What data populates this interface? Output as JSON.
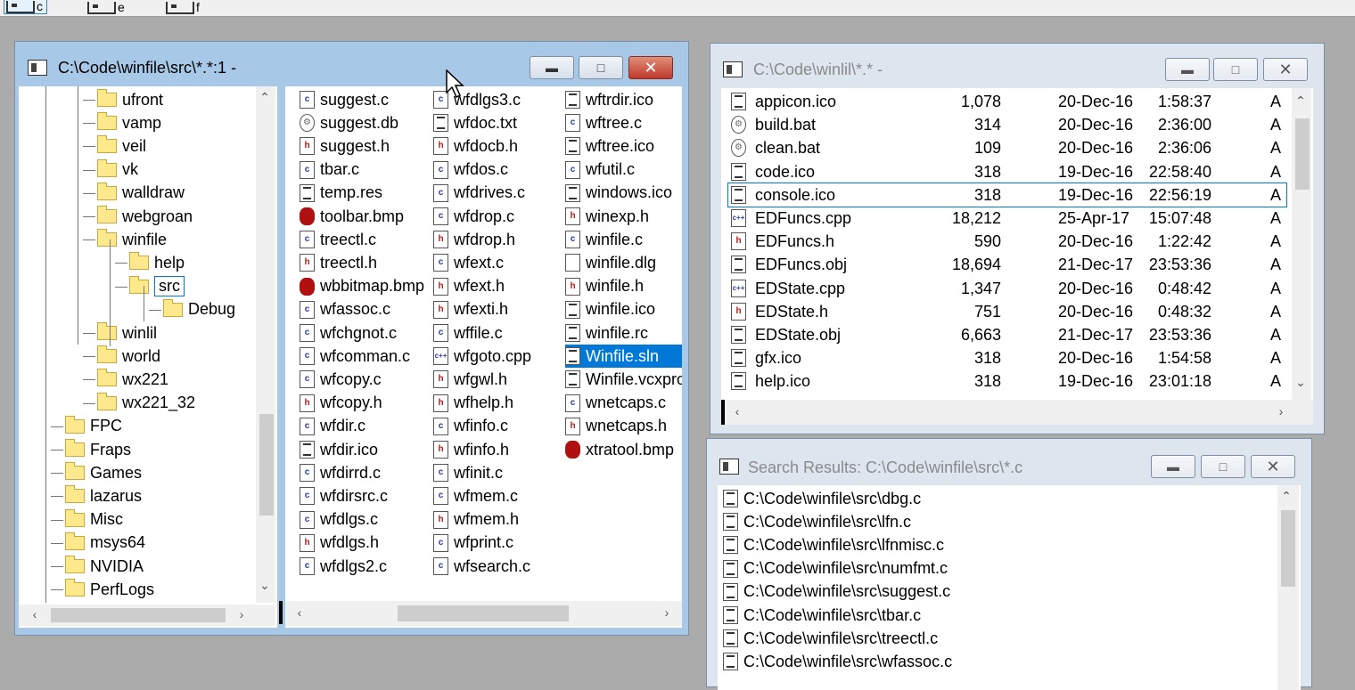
{
  "drivebar": {
    "drives": [
      "c",
      "e",
      "f"
    ]
  },
  "win1": {
    "title": "C:\\Code\\winfile\\src\\*.*:1 -",
    "tree": [
      {
        "label": "ufront"
      },
      {
        "label": "vamp"
      },
      {
        "label": "veil"
      },
      {
        "label": "vk"
      },
      {
        "label": "walldraw"
      },
      {
        "label": "webgroan"
      },
      {
        "label": "winfile"
      },
      {
        "label": "help"
      },
      {
        "label": "src"
      },
      {
        "label": "Debug"
      },
      {
        "label": "winlil"
      },
      {
        "label": "world"
      },
      {
        "label": "wx221"
      },
      {
        "label": "wx221_32"
      },
      {
        "label": "FPC"
      },
      {
        "label": "Fraps"
      },
      {
        "label": "Games"
      },
      {
        "label": "lazarus"
      },
      {
        "label": "Misc"
      },
      {
        "label": "msys64"
      },
      {
        "label": "NVIDIA"
      },
      {
        "label": "PerfLogs"
      }
    ],
    "files_col1": [
      {
        "name": "suggest.c",
        "t": "c"
      },
      {
        "name": "suggest.db",
        "t": "db"
      },
      {
        "name": "suggest.h",
        "t": "h"
      },
      {
        "name": "tbar.c",
        "t": "c"
      },
      {
        "name": "temp.res",
        "t": "doc"
      },
      {
        "name": "toolbar.bmp",
        "t": "bmp"
      },
      {
        "name": "treectl.c",
        "t": "c"
      },
      {
        "name": "treectl.h",
        "t": "h"
      },
      {
        "name": "wbbitmap.bmp",
        "t": "bmp"
      },
      {
        "name": "wfassoc.c",
        "t": "c"
      },
      {
        "name": "wfchgnot.c",
        "t": "c"
      },
      {
        "name": "wfcomman.c",
        "t": "c"
      },
      {
        "name": "wfcopy.c",
        "t": "c"
      },
      {
        "name": "wfcopy.h",
        "t": "h"
      },
      {
        "name": "wfdir.c",
        "t": "c"
      },
      {
        "name": "wfdir.ico",
        "t": "doc"
      },
      {
        "name": "wfdirrd.c",
        "t": "c"
      },
      {
        "name": "wfdirsrc.c",
        "t": "c"
      },
      {
        "name": "wfdlgs.c",
        "t": "c"
      },
      {
        "name": "wfdlgs.h",
        "t": "h"
      },
      {
        "name": "wfdlgs2.c",
        "t": "c"
      }
    ],
    "files_col2": [
      {
        "name": "wfdlgs3.c",
        "t": "c"
      },
      {
        "name": "wfdoc.txt",
        "t": "doc"
      },
      {
        "name": "wfdocb.h",
        "t": "h"
      },
      {
        "name": "wfdos.c",
        "t": "c"
      },
      {
        "name": "wfdrives.c",
        "t": "c"
      },
      {
        "name": "wfdrop.c",
        "t": "c"
      },
      {
        "name": "wfdrop.h",
        "t": "h"
      },
      {
        "name": "wfext.c",
        "t": "c"
      },
      {
        "name": "wfext.h",
        "t": "h"
      },
      {
        "name": "wfexti.h",
        "t": "h"
      },
      {
        "name": "wffile.c",
        "t": "c"
      },
      {
        "name": "wfgoto.cpp",
        "t": "cpp"
      },
      {
        "name": "wfgwl.h",
        "t": "h"
      },
      {
        "name": "wfhelp.h",
        "t": "h"
      },
      {
        "name": "wfinfo.c",
        "t": "c"
      },
      {
        "name": "wfinfo.h",
        "t": "h"
      },
      {
        "name": "wfinit.c",
        "t": "c"
      },
      {
        "name": "wfmem.c",
        "t": "c"
      },
      {
        "name": "wfmem.h",
        "t": "h"
      },
      {
        "name": "wfprint.c",
        "t": "c"
      },
      {
        "name": "wfsearch.c",
        "t": "c"
      }
    ],
    "files_col3": [
      {
        "name": "wftrdir.ico",
        "t": "doc"
      },
      {
        "name": "wftree.c",
        "t": "c"
      },
      {
        "name": "wftree.ico",
        "t": "doc"
      },
      {
        "name": "wfutil.c",
        "t": "c"
      },
      {
        "name": "windows.ico",
        "t": "doc"
      },
      {
        "name": "winexp.h",
        "t": "h"
      },
      {
        "name": "winfile.c",
        "t": "c"
      },
      {
        "name": "winfile.dlg",
        "t": "blank"
      },
      {
        "name": "winfile.h",
        "t": "h"
      },
      {
        "name": "winfile.ico",
        "t": "doc"
      },
      {
        "name": "winfile.rc",
        "t": "doc"
      },
      {
        "name": "Winfile.sln",
        "t": "doc"
      },
      {
        "name": "Winfile.vcxpro",
        "t": "doc"
      },
      {
        "name": "wnetcaps.c",
        "t": "c"
      },
      {
        "name": "wnetcaps.h",
        "t": "h"
      },
      {
        "name": "xtratool.bmp",
        "t": "bmp"
      }
    ]
  },
  "win2": {
    "title": "C:\\Code\\winlil\\*.* -",
    "rows": [
      {
        "name": "appicon.ico",
        "size": "1,078",
        "date": "20-Dec-16",
        "time": "1:58:37",
        "attr": "A",
        "t": "doc"
      },
      {
        "name": "build.bat",
        "size": "314",
        "date": "20-Dec-16",
        "time": "2:36:00",
        "attr": "A",
        "t": "db"
      },
      {
        "name": "clean.bat",
        "size": "109",
        "date": "20-Dec-16",
        "time": "2:36:06",
        "attr": "A",
        "t": "db"
      },
      {
        "name": "code.ico",
        "size": "318",
        "date": "19-Dec-16",
        "time": "22:58:40",
        "attr": "A",
        "t": "doc"
      },
      {
        "name": "console.ico",
        "size": "318",
        "date": "19-Dec-16",
        "time": "22:56:19",
        "attr": "A",
        "t": "doc"
      },
      {
        "name": "EDFuncs.cpp",
        "size": "18,212",
        "date": "25-Apr-17",
        "time": "15:07:48",
        "attr": "A",
        "t": "cpp"
      },
      {
        "name": "EDFuncs.h",
        "size": "590",
        "date": "20-Dec-16",
        "time": "1:22:42",
        "attr": "A",
        "t": "h"
      },
      {
        "name": "EDFuncs.obj",
        "size": "18,694",
        "date": "21-Dec-17",
        "time": "23:53:36",
        "attr": "A",
        "t": "doc"
      },
      {
        "name": "EDState.cpp",
        "size": "1,347",
        "date": "20-Dec-16",
        "time": "0:48:42",
        "attr": "A",
        "t": "cpp"
      },
      {
        "name": "EDState.h",
        "size": "751",
        "date": "20-Dec-16",
        "time": "0:48:32",
        "attr": "A",
        "t": "h"
      },
      {
        "name": "EDState.obj",
        "size": "6,663",
        "date": "21-Dec-17",
        "time": "23:53:36",
        "attr": "A",
        "t": "doc"
      },
      {
        "name": "gfx.ico",
        "size": "318",
        "date": "20-Dec-16",
        "time": "1:54:58",
        "attr": "A",
        "t": "doc"
      },
      {
        "name": "help.ico",
        "size": "318",
        "date": "19-Dec-16",
        "time": "23:01:18",
        "attr": "A",
        "t": "doc"
      }
    ]
  },
  "win3": {
    "title": "Search Results: C:\\Code\\winfile\\src\\*.c",
    "results": [
      "C:\\Code\\winfile\\src\\dbg.c",
      "C:\\Code\\winfile\\src\\lfn.c",
      "C:\\Code\\winfile\\src\\lfnmisc.c",
      "C:\\Code\\winfile\\src\\numfmt.c",
      "C:\\Code\\winfile\\src\\suggest.c",
      "C:\\Code\\winfile\\src\\tbar.c",
      "C:\\Code\\winfile\\src\\treectl.c",
      "C:\\Code\\winfile\\src\\wfassoc.c"
    ]
  }
}
